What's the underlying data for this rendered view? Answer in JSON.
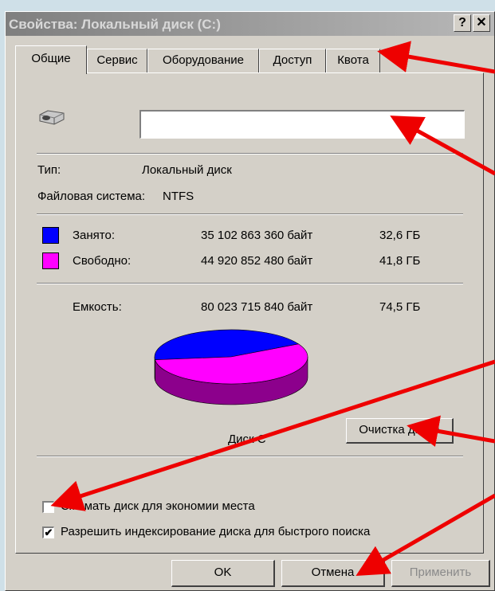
{
  "window": {
    "title": "Свойства: Локальный диск (C:)",
    "help_label": "?",
    "close_label": "✕"
  },
  "tabs": [
    {
      "label": "Общие",
      "active": true
    },
    {
      "label": "Сервис",
      "active": false
    },
    {
      "label": "Оборудование",
      "active": false
    },
    {
      "label": "Доступ",
      "active": false
    },
    {
      "label": "Квота",
      "active": false
    }
  ],
  "general": {
    "volume_label_value": "",
    "type_label": "Тип:",
    "type_value": "Локальный диск",
    "fs_label": "Файловая система:",
    "fs_value": "NTFS",
    "used": {
      "label": "Занято:",
      "bytes": "35 102 863 360 байт",
      "size": "32,6 ГБ",
      "color": "#0000ff"
    },
    "free": {
      "label": "Свободно:",
      "bytes": "44 920 852 480 байт",
      "size": "41,8 ГБ",
      "color": "#ff00ff"
    },
    "capacity": {
      "label": "Емкость:",
      "bytes": "80 023 715 840 байт",
      "size": "74,5 ГБ"
    },
    "disk_label": "Диск C",
    "cleanup_button": "Очистка диска",
    "compress_label": "Сжимать диск для экономии места",
    "compress_checked": false,
    "index_label": "Разрешить индексирование диска для быстрого поиска",
    "index_checked": true,
    "check_mark": "✔"
  },
  "buttons": {
    "ok": "OK",
    "cancel": "Отмена",
    "apply": "Применить"
  },
  "chart_data": {
    "type": "pie",
    "categories": [
      "Занято",
      "Свободно"
    ],
    "values": [
      35102863360,
      44920852480
    ],
    "colors": [
      "#0000ff",
      "#ff00ff"
    ]
  },
  "annotation_color": "#ee0000"
}
